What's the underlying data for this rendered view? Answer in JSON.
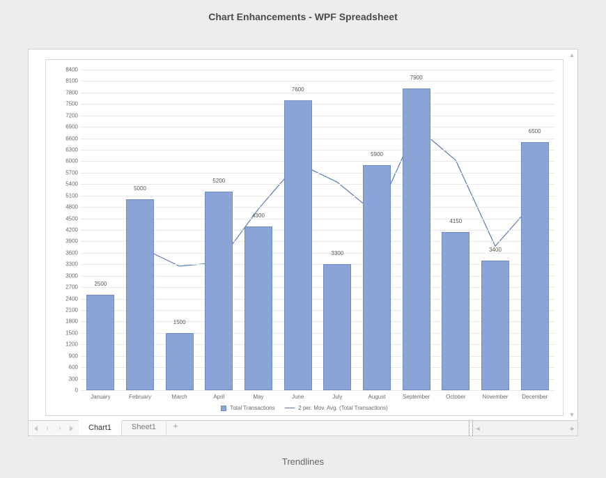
{
  "header": {
    "title": "Chart Enhancements - WPF Spreadsheet"
  },
  "tabs": {
    "nav_first": "⏮",
    "nav_prev": "‹",
    "nav_next": "›",
    "nav_last": "⏭",
    "items": [
      {
        "label": "Chart1",
        "active": true
      },
      {
        "label": "Sheet1",
        "active": false
      }
    ],
    "add_label": "+"
  },
  "caption": "Trendlines",
  "chart_data": {
    "type": "bar",
    "categories": [
      "January",
      "February",
      "March",
      "April",
      "May",
      "June",
      "July",
      "August",
      "September",
      "October",
      "November",
      "December"
    ],
    "values": [
      2500,
      5000,
      1500,
      5200,
      4300,
      7600,
      3300,
      5900,
      7900,
      4150,
      3400,
      6500
    ],
    "moving_avg_2": [
      null,
      3750,
      3250,
      3350,
      4750,
      5950,
      5450,
      4600,
      6900,
      6025,
      3775,
      4950
    ],
    "y_ticks": [
      0,
      300,
      600,
      900,
      1200,
      1500,
      1800,
      2100,
      2400,
      2700,
      3000,
      3300,
      3600,
      3900,
      4200,
      4500,
      4800,
      5100,
      5400,
      5700,
      6000,
      6300,
      6600,
      6900,
      7200,
      7500,
      7800,
      8100,
      8400
    ],
    "ylim": [
      0,
      8400
    ],
    "title": "",
    "xlabel": "",
    "ylabel": "",
    "legend": {
      "series_label": "Total Transactions",
      "trend_label": "2 per. Mov. Avg. (Total Transactions)"
    },
    "colors": {
      "bar": "#8aa4d6",
      "bar_border": "#6d8bc5",
      "line": "#5b7ab8"
    }
  }
}
